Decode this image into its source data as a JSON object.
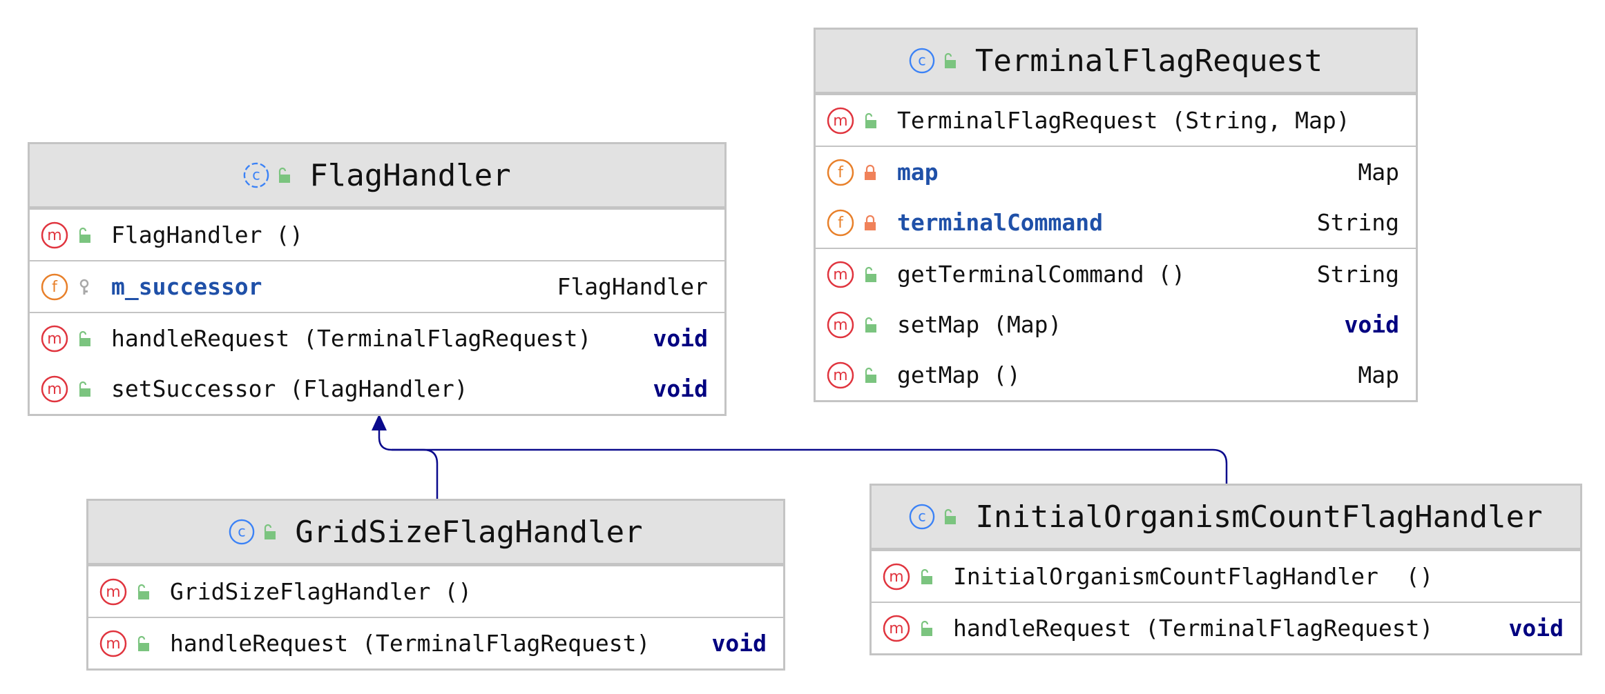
{
  "colors": {
    "method": "#e0343e",
    "field": "#e8802a",
    "class": "#3b82f6",
    "public": "#7bc47f",
    "private": "#f0825a",
    "package": "#a8a8a8",
    "field_name": "#1f50a8",
    "keyword": "#000080",
    "arrow": "#0a0a8c"
  },
  "classes": {
    "terminal_flag_request": {
      "name": "TerminalFlagRequest",
      "abstract": false,
      "sections": [
        [
          {
            "kind": "method",
            "visibility": "public",
            "label": "TerminalFlagRequest (String, Map)",
            "type": ""
          }
        ],
        [
          {
            "kind": "field",
            "visibility": "private",
            "label": "map",
            "type": "Map"
          },
          {
            "kind": "field",
            "visibility": "private",
            "label": "terminalCommand",
            "type": "String"
          }
        ],
        [
          {
            "kind": "method",
            "visibility": "public",
            "label": "getTerminalCommand ()",
            "type": "String"
          },
          {
            "kind": "method",
            "visibility": "public",
            "label": "setMap (Map)",
            "type": "void"
          },
          {
            "kind": "method",
            "visibility": "public",
            "label": "getMap ()",
            "type": "Map"
          }
        ]
      ]
    },
    "flag_handler": {
      "name": "FlagHandler",
      "abstract": true,
      "sections": [
        [
          {
            "kind": "method",
            "visibility": "public",
            "label": "FlagHandler ()",
            "type": ""
          }
        ],
        [
          {
            "kind": "field",
            "visibility": "package",
            "label": "m_successor",
            "type": "FlagHandler"
          }
        ],
        [
          {
            "kind": "method",
            "visibility": "public",
            "label": "handleRequest (TerminalFlagRequest)",
            "type": "void"
          },
          {
            "kind": "method",
            "visibility": "public",
            "label": "setSuccessor (FlagHandler)",
            "type": "void"
          }
        ]
      ]
    },
    "grid_size_flag_handler": {
      "name": "GridSizeFlagHandler",
      "abstract": false,
      "sections": [
        [
          {
            "kind": "method",
            "visibility": "public",
            "label": "GridSizeFlagHandler ()",
            "type": ""
          }
        ],
        [
          {
            "kind": "method",
            "visibility": "public",
            "label": "handleRequest (TerminalFlagRequest)",
            "type": "void"
          }
        ]
      ]
    },
    "initial_organism_count_flag_handler": {
      "name": "InitialOrganismCountFlagHandler",
      "abstract": false,
      "sections": [
        [
          {
            "kind": "method",
            "visibility": "public",
            "label": "InitialOrganismCountFlagHandler  ()",
            "type": ""
          }
        ],
        [
          {
            "kind": "method",
            "visibility": "public",
            "label": "handleRequest (TerminalFlagRequest)",
            "type": "void"
          }
        ]
      ]
    }
  },
  "relations": [
    {
      "from": "GridSizeFlagHandler",
      "to": "FlagHandler",
      "kind": "extends"
    },
    {
      "from": "InitialOrganismCountFlagHandler",
      "to": "FlagHandler",
      "kind": "extends"
    }
  ]
}
